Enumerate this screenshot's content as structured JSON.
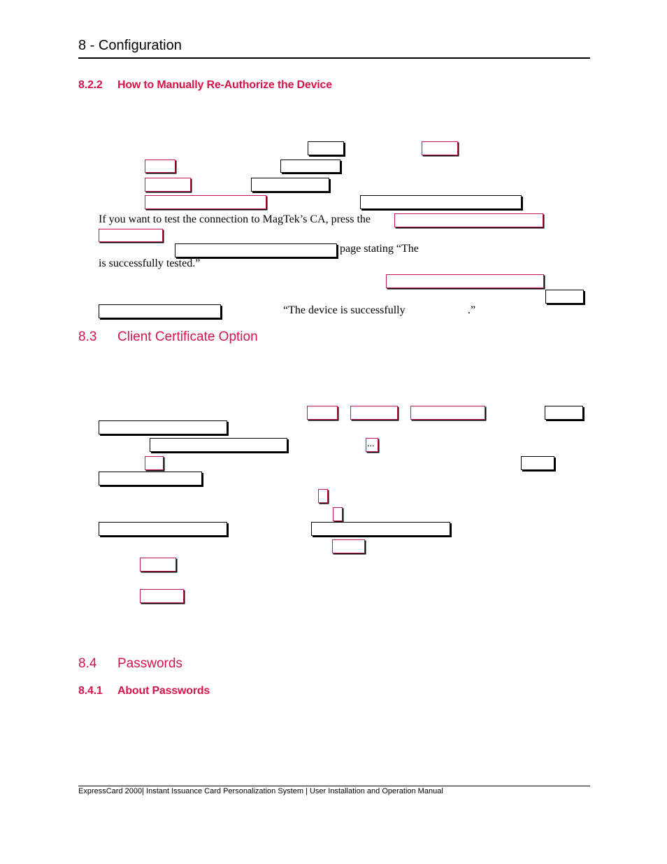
{
  "header": {
    "chapter_title": "8 - Configuration"
  },
  "sections": {
    "s822": {
      "number": "8.2.2",
      "title": "How to Manually Re-Authorize the Device"
    },
    "s83": {
      "number": "8.3",
      "title": "Client Certificate Option"
    },
    "s84": {
      "number": "8.4",
      "title": "Passwords"
    },
    "s841": {
      "number": "8.4.1",
      "title": "About Passwords"
    }
  },
  "body_text": {
    "test_connection": "If you want to test the connection to MagTek’s CA, press the",
    "page_stating": "page stating “The",
    "successfully_tested": "is successfully tested.”",
    "device_success_open": "“The device is successfully",
    "device_success_close": ".”"
  },
  "ui_ref_boxes": {
    "ellipsis_button_label": "..."
  },
  "footer": {
    "text": "ExpressCard 2000| Instant Issuance Card Personalization System | User Installation and Operation Manual"
  },
  "colors": {
    "heading_accent": "#d4164b",
    "ui_ref_border": "#c2185b",
    "text": "#000000"
  }
}
